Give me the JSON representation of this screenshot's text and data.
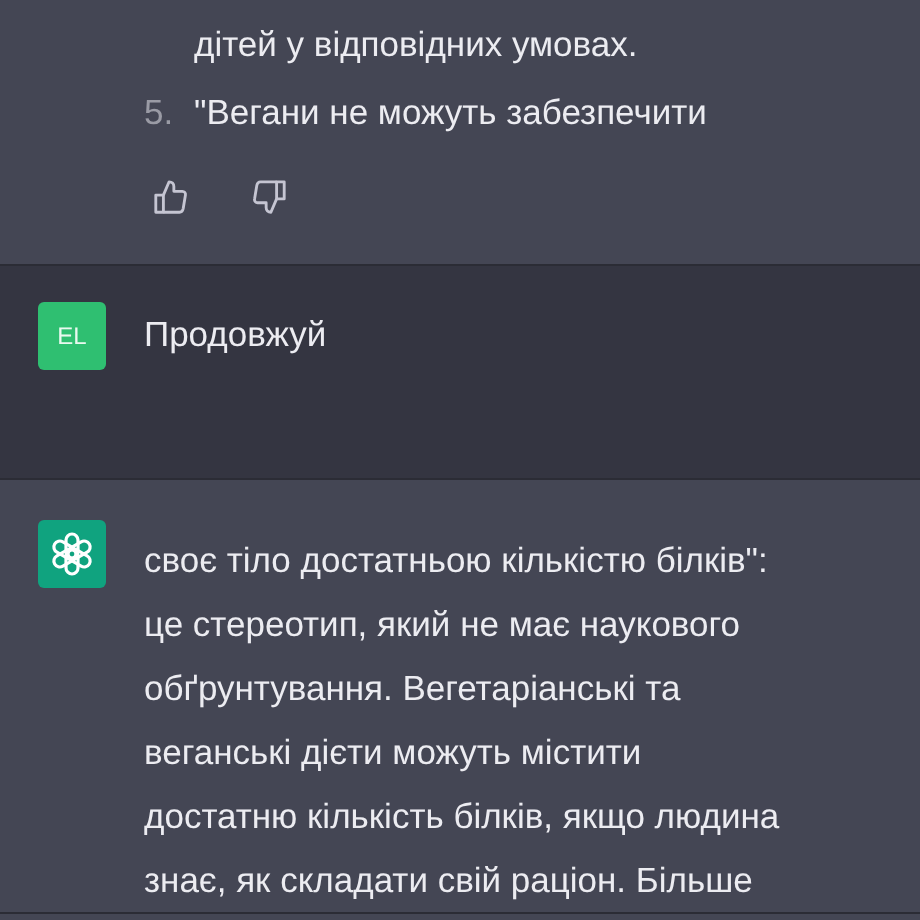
{
  "messages": [
    {
      "kind": "assistant",
      "has_avatar": false,
      "feedback": true,
      "lines": [
        {
          "kind": "continuation",
          "text": "дітей у відповідних умовах."
        },
        {
          "kind": "list_item",
          "number": "5.",
          "text": "\"Вегани не можуть забезпечити"
        }
      ]
    },
    {
      "kind": "user",
      "avatar": "EL",
      "feedback": false,
      "lines": [
        {
          "kind": "paragraph",
          "text": "Продовжуй"
        }
      ]
    },
    {
      "kind": "assistant",
      "has_avatar": true,
      "feedback": false,
      "lines": [
        {
          "kind": "paragraph",
          "text": "своє тіло достатньою кількістю білків\":"
        },
        {
          "kind": "paragraph",
          "text": "це стереотип, який не має наукового"
        },
        {
          "kind": "paragraph",
          "text": "обґрунтування. Вегетаріанські та"
        },
        {
          "kind": "paragraph",
          "text": "веганські дієти можуть містити"
        },
        {
          "kind": "paragraph",
          "text": "достатню кількість білків, якщо людина"
        },
        {
          "kind": "paragraph",
          "text": "знає, як складати свій раціон. Більше"
        }
      ]
    }
  ]
}
